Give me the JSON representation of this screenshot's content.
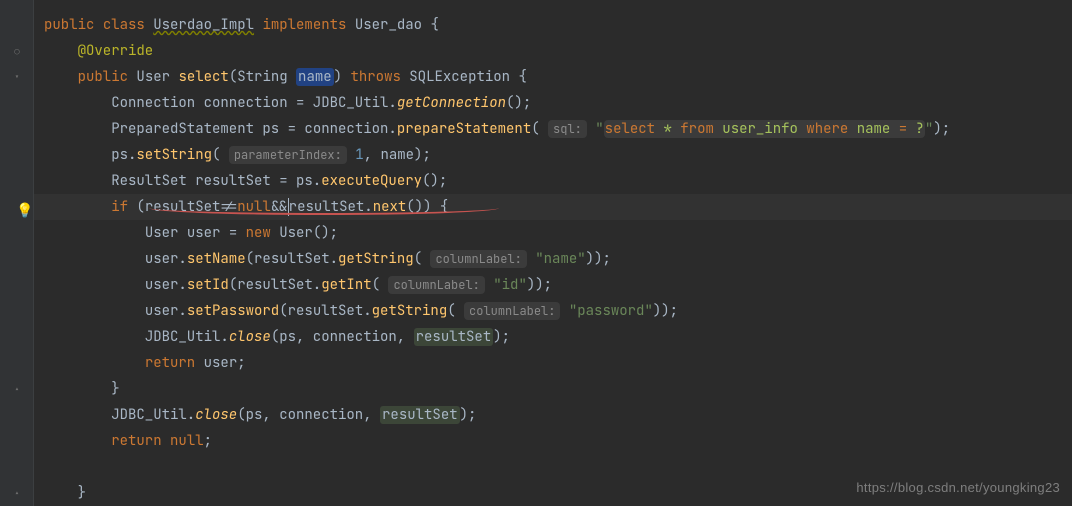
{
  "l1": {
    "kw1": "public",
    "kw2": "class",
    "name": "Userdao_Impl",
    "kw3": "implements",
    "impl": "User_dao",
    "brace": "{"
  },
  "l2": {
    "anno": "@Override"
  },
  "l3": {
    "kw1": "public",
    "ret": "User",
    "fn": "select",
    "sig": "(String ",
    "param": "name",
    "close": ") ",
    "kw2": "throws",
    "exc": " SQLException {"
  },
  "l4": {
    "type": "Connection ",
    "var": "connection",
    "eq": " = JDBC_Util.",
    "fn": "getConnection",
    "tail": "();"
  },
  "l5": {
    "pre": "PreparedStatement ",
    "var": "ps",
    "mid": " = connection.",
    "fn": "prepareStatement",
    "open": "( ",
    "hint": "sql:",
    "quote1": "\"",
    "s1": "select",
    "sp1": " * ",
    "s2": "from",
    "t1": " user_info ",
    "s3": "where",
    "t2": " name ",
    "s4": "=",
    "t3": " ?",
    "quote2": "\"",
    "close": ");"
  },
  "l6": {
    "pre": "ps.",
    "fn": "setString",
    "open": "( ",
    "hint": "parameterIndex:",
    "num": " 1",
    "rest": ", name);"
  },
  "l7": {
    "type": "ResultSet ",
    "var": "resultSet",
    "eq": " = ps.",
    "fn": "executeQuery",
    "tail": "();"
  },
  "l8": {
    "kw": "if",
    "open": " (",
    "a": "resultSet",
    "ne": "!=",
    "nul": "null",
    "and": "&&",
    "b": "resultSet",
    "dot": ".",
    "fn": "next",
    "tail": "()) {"
  },
  "l9": {
    "type": "User ",
    "var": "user",
    "eq": " = ",
    "kw": "new",
    "ctor": " User();"
  },
  "l10": {
    "pre": "user.",
    "fn": "setName",
    "mid": "(resultSet.",
    "fn2": "getString",
    "open": "( ",
    "hint": "columnLabel:",
    "str": " \"name\"",
    "tail": "));"
  },
  "l11": {
    "pre": "user.",
    "fn": "setId",
    "mid": "(resultSet.",
    "fn2": "getInt",
    "open": "( ",
    "hint": "columnLabel:",
    "str": " \"id\"",
    "tail": "));"
  },
  "l12": {
    "pre": "user.",
    "fn": "setPassword",
    "mid": "(resultSet.",
    "fn2": "getString",
    "open": "( ",
    "hint": "columnLabel:",
    "str": " \"password\"",
    "tail": "));"
  },
  "l13": {
    "pre": "JDBC_Util.",
    "fn": "close",
    "args": "(ps, connection, ",
    "rs": "resultSet",
    "tail": ");"
  },
  "l14": {
    "kw": "return",
    "val": " user;"
  },
  "l15": {
    "brace": "}"
  },
  "l16": {
    "pre": "JDBC_Util.",
    "fn": "close",
    "args": "(ps, connection, ",
    "rs": "resultSet",
    "tail": ");"
  },
  "l17": {
    "kw": "return",
    "val": " ",
    "nul": "null",
    "semi": ";"
  },
  "l19": {
    "brace": "}"
  },
  "watermark": "https://blog.csdn.net/youngking23"
}
